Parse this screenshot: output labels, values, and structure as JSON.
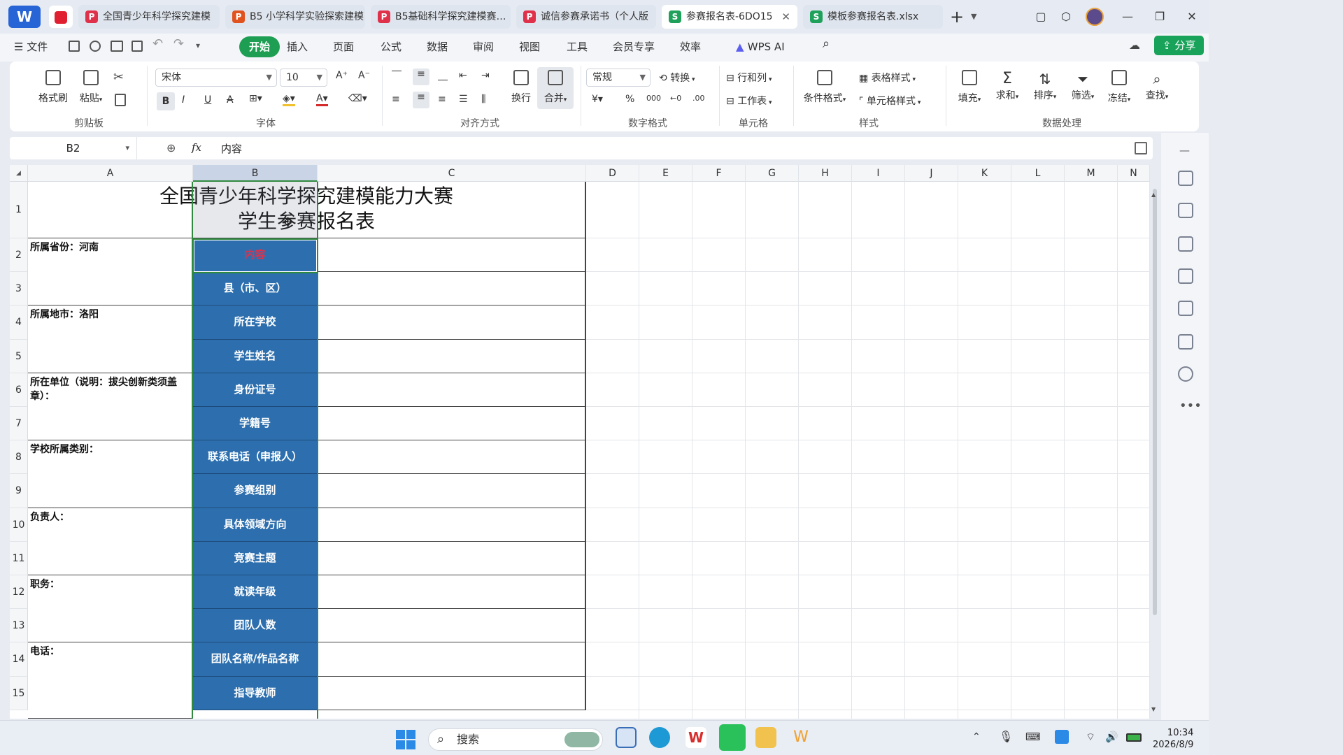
{
  "tabs": [
    {
      "label": "全国青少年科学探究建模",
      "icon": "pdf-icon",
      "color": "#e0314b"
    },
    {
      "label": "B5 小学科学实验探索建模",
      "icon": "ppt-icon",
      "color": "#e0531e"
    },
    {
      "label": "B5基础科学探究建模赛…",
      "icon": "pdf-icon",
      "color": "#e0314b"
    },
    {
      "label": "诚信参赛承诺书（个人版",
      "icon": "pdf-icon",
      "color": "#e0314b"
    },
    {
      "label": "参赛报名表-6DO15",
      "icon": "sheet-icon",
      "color": "#1fa15b",
      "active": true
    },
    {
      "label": "模板参赛报名表.xlsx",
      "icon": "sheet-icon",
      "color": "#1fa15b"
    }
  ],
  "menu": {
    "file": "文件",
    "items": [
      "开始",
      "插入",
      "页面",
      "公式",
      "数据",
      "审阅",
      "视图",
      "工具",
      "会员专享",
      "效率"
    ],
    "wps_ai": "WPS AI",
    "share": "分享"
  },
  "ribbon": {
    "format_painter": "格式刷",
    "paste": "粘贴",
    "font_name": "宋体",
    "font_size": "10",
    "wrap": "换行",
    "merge": "合并",
    "number_format": "常规",
    "convert": "转换",
    "row_col": "行和列",
    "worksheet": "工作表",
    "cond_format": "条件格式",
    "table_style": "表格样式",
    "cell_style": "单元格样式",
    "fill": "填充",
    "sum": "求和",
    "sort": "排序",
    "filter": "筛选",
    "freeze": "冻结",
    "find": "查找",
    "groups": [
      "剪贴板",
      "字体",
      "对齐方式",
      "数字格式",
      "单元格",
      "样式",
      "数据处理"
    ]
  },
  "formula_bar": {
    "cell_ref": "B2",
    "fx": "fx",
    "content": "内容"
  },
  "columns": [
    "A",
    "B",
    "C",
    "D",
    "E",
    "F",
    "G",
    "H",
    "I",
    "J",
    "K",
    "L",
    "M",
    "N"
  ],
  "rows": [
    "1",
    "2",
    "3",
    "4",
    "5",
    "6",
    "7",
    "8",
    "9",
    "10",
    "11",
    "12",
    "13",
    "14",
    "15"
  ],
  "sheet": {
    "title_line1": "全国青少年科学探究建模能力大赛",
    "title_line2": "学生参赛报名表",
    "col_a": [
      "所属省份：河南",
      "所属地市：洛阳",
      "所在单位（说明：拔尖创新类须盖章）：",
      "学校所属类别：",
      "负责人：",
      "职务：",
      "电话："
    ],
    "col_b": [
      "内容",
      "县（市、区）",
      "所在学校",
      "学生姓名",
      "身份证号",
      "学籍号",
      "联系电话（申报人）",
      "参赛组别",
      "具体领域方向",
      "竞赛主题",
      "就读年级",
      "团队人数",
      "团队名称/作品名称",
      "指导教师"
    ],
    "highlight_color": "#e0314b"
  },
  "taskbar": {
    "search": "搜索",
    "time": "10:34",
    "date": "2026/8/9"
  }
}
